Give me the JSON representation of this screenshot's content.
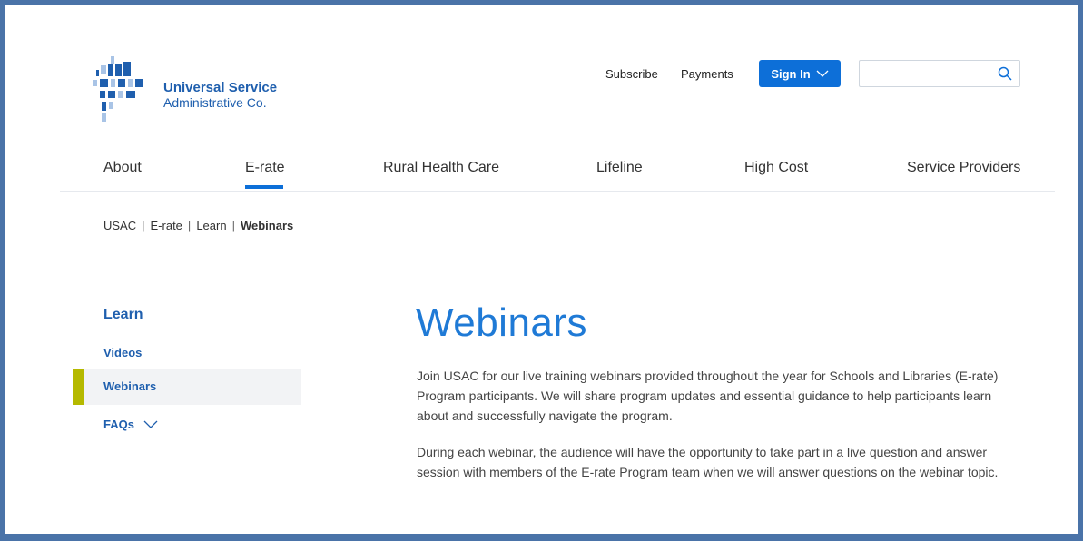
{
  "brand": {
    "line1": "Universal Service",
    "line2": "Administrative Co.",
    "colors": {
      "blue": "#1f5fae",
      "accent_blue": "#0d6fd8",
      "light_blue": "#a9c4e6",
      "olive": "#b5b900"
    }
  },
  "utility": {
    "subscribe": "Subscribe",
    "payments": "Payments",
    "sign_in": "Sign In",
    "search_placeholder": ""
  },
  "nav": {
    "items": [
      {
        "label": "About"
      },
      {
        "label": "E-rate",
        "active": true
      },
      {
        "label": "Rural Health Care"
      },
      {
        "label": "Lifeline"
      },
      {
        "label": "High Cost"
      },
      {
        "label": "Service Providers"
      }
    ]
  },
  "breadcrumb": {
    "items": [
      "USAC",
      "E-rate",
      "Learn"
    ],
    "current": "Webinars",
    "separator": "|"
  },
  "sidebar": {
    "title": "Learn",
    "items": [
      {
        "label": "Videos"
      },
      {
        "label": "Webinars",
        "active": true
      },
      {
        "label": "FAQs"
      }
    ]
  },
  "main": {
    "title": "Webinars",
    "paragraphs": [
      "Join USAC for our live training webinars provided throughout the year for Schools and Libraries (E-rate) Program participants. We will share program updates and essential guidance to help participants learn about and successfully navigate the program.",
      "During each webinar, the audience will have the opportunity to take part in a live question and answer session with members of the E-rate Program team when we will answer questions on the webinar topic."
    ]
  }
}
